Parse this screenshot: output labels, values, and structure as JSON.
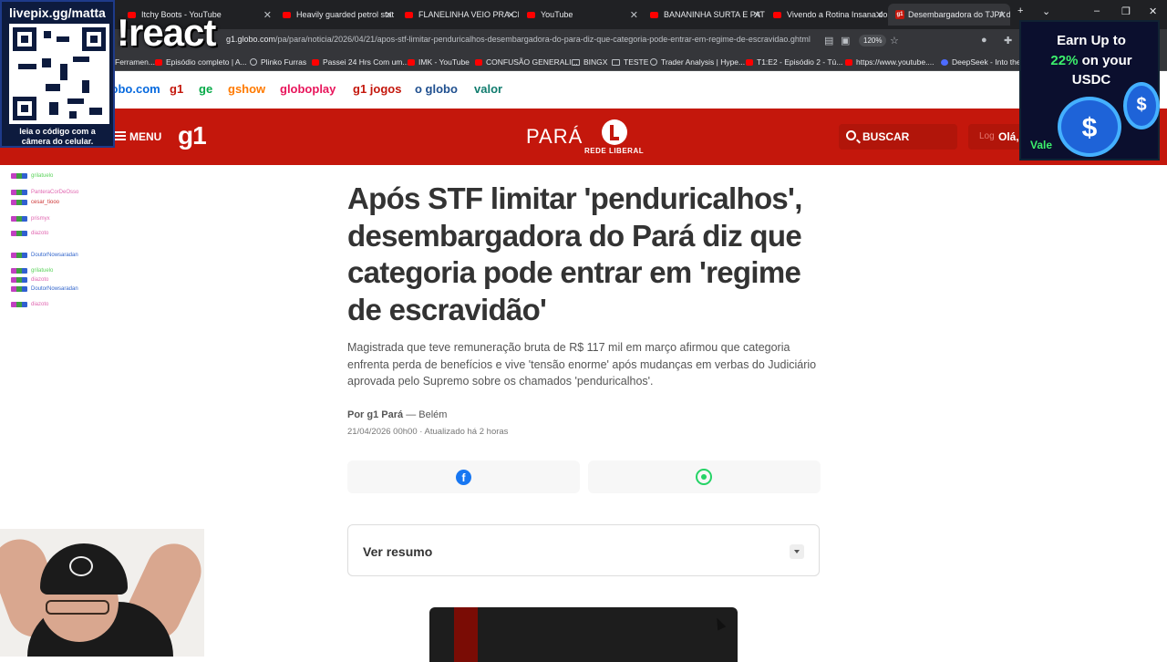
{
  "browser": {
    "tabs": [
      {
        "label": "Itchy Boots - YouTube",
        "icon": "youtube-icon",
        "active": false
      },
      {
        "label": "Heavily guarded petrol stat",
        "icon": "youtube-icon",
        "active": false
      },
      {
        "label": "FLANELINHA VEIO PRA CIM",
        "icon": "youtube-icon",
        "active": false
      },
      {
        "label": "YouTube",
        "icon": "youtube-icon",
        "active": false
      },
      {
        "label": "BANANINHA SURTA E PATI",
        "icon": "youtube-icon",
        "active": false
      },
      {
        "label": "Vivendo a Rotina Insana do",
        "icon": "youtube-icon",
        "active": false
      },
      {
        "label": "Desembargadora do TJPA d",
        "icon": "g1-icon",
        "active": true
      }
    ],
    "url_host": "g1.globo.com",
    "url_path": "/pa/para/noticia/2026/04/21/apos-stf-limitar-penduricalhos-desembargadora-do-para-diz-que-categoria-pode-entrar-em-regime-de-escravidao.ghtml",
    "zoom": "120%",
    "bookmarks": [
      {
        "label": "Ferramen...",
        "icon": "folder-icon"
      },
      {
        "label": "Episódio completo | A...",
        "icon": "youtube-icon"
      },
      {
        "label": "Plinko Furras",
        "icon": "globe-icon"
      },
      {
        "label": "Passei 24 Hrs Com um...",
        "icon": "youtube-icon"
      },
      {
        "label": "IMK - YouTube",
        "icon": "youtube-icon"
      },
      {
        "label": "CONFUSÃO GENERALI...",
        "icon": "youtube-icon"
      },
      {
        "label": "BINGX",
        "icon": "folder-icon"
      },
      {
        "label": "TESTE",
        "icon": "folder-icon"
      },
      {
        "label": "Trader Analysis | Hype...",
        "icon": "globe-icon"
      },
      {
        "label": "T1:E2 - Episódio 2 - Tú...",
        "icon": "youtube-icon"
      },
      {
        "label": "https://www.youtube....",
        "icon": "youtube-icon"
      },
      {
        "label": "DeepSeek - Into the ...",
        "icon": "deepseek-icon"
      }
    ]
  },
  "globo_nav": [
    {
      "label": "globo.com",
      "color": "#0669de"
    },
    {
      "label": "g1",
      "color": "#c4170c"
    },
    {
      "label": "ge",
      "color": "#06aa48"
    },
    {
      "label": "gshow",
      "color": "#ff7a00"
    },
    {
      "label": "globoplay",
      "color": "#e8155b"
    },
    {
      "label": "g1 jogos",
      "color": "#c4170c"
    },
    {
      "label": "o globo",
      "color": "#1f4f8f"
    },
    {
      "label": "valor",
      "color": "#107c6e"
    }
  ],
  "header": {
    "menu_label": "MENU",
    "logo": "g1",
    "region": "PARÁ",
    "affiliate": "REDE LIBERAL",
    "search_label": "BUSCAR",
    "login_placeholder": "Log",
    "greeting": "Olá,",
    "brand_color": "#c4170c"
  },
  "article": {
    "title": "Após STF limitar 'penduricalhos', desembargadora do Pará diz que categoria pode entrar em 'regime de escravidão'",
    "subtitle": "Magistrada que teve remuneração bruta de R$ 117 mil em março afirmou que categoria enfrenta perda de benefícios e vive 'tensão enorme' após mudanças em verbas do Judiciário aprovada pelo Supremo sobre os chamados 'penduricalhos'.",
    "author": "Por g1 Pará",
    "location": "— Belém",
    "date": "21/04/2026 00h00 · Atualizado há 2 horas",
    "summary_label": "Ver resumo"
  },
  "overlays": {
    "qr_handle": "livepix.gg/matta",
    "qr_caption_1": "leia o código com a",
    "qr_caption_2": "câmera do celular.",
    "react_command": "!react",
    "promo_line1": "Earn Up to",
    "promo_pct": "22%",
    "promo_line2": " on your",
    "promo_line3": "USDC",
    "promo_vale": "Vale"
  },
  "chat": [
    {
      "user": "grilatuelo",
      "color": "#5bd35b"
    },
    {
      "user": "PanteraCorDeOsso",
      "color": "#e066b0"
    },
    {
      "user": "cesar_tiooo",
      "color": "#cc3333"
    },
    {
      "user": "prismyx",
      "color": "#e066b0"
    },
    {
      "user": "diazoto",
      "color": "#e066b0"
    },
    {
      "user": "DoutorNowsaradan",
      "color": "#3366cc"
    },
    {
      "user": "grilatuelo",
      "color": "#5bd35b"
    },
    {
      "user": "diazoto",
      "color": "#e066b0"
    },
    {
      "user": "DoutorNowsaradan",
      "color": "#3366cc"
    },
    {
      "user": "diazoto",
      "color": "#e066b0"
    }
  ]
}
